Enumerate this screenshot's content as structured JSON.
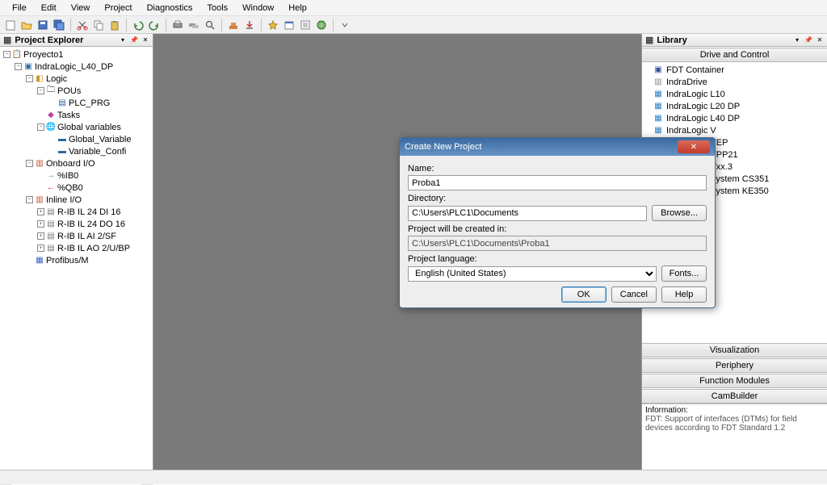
{
  "menu": [
    "File",
    "Edit",
    "View",
    "Project",
    "Diagnostics",
    "Tools",
    "Window",
    "Help"
  ],
  "explorer": {
    "title": "Project Explorer",
    "root": "Proyecto1",
    "indra": "IndraLogic_L40_DP",
    "logic": "Logic",
    "pous": "POUs",
    "plc_prg": "PLC_PRG",
    "tasks": "Tasks",
    "globals": "Global variables",
    "gvar": "Global_Variable",
    "vconf": "Variable_Confi",
    "onboard": "Onboard I/O",
    "ib0": "%IB0",
    "qb0": "%QB0",
    "inline": "Inline I/O",
    "io1": "R-IB IL 24 DI 16",
    "io2": "R-IB IL 24 DO 16",
    "io3": "R-IB IL AI 2/SF",
    "io4": "R-IB IL AO 2/U/BP",
    "profibus": "Profibus/M"
  },
  "library": {
    "title": "Library",
    "cat1": "Drive and Control",
    "items": [
      "FDT Container",
      "IndraDrive",
      "IndraLogic L10",
      "IndraLogic L20 DP",
      "IndraLogic L40 DP",
      "IndraLogic V",
      "IndraLogic VEP",
      "IndraLogic VPP21",
      "IndraLogic Vxx.3",
      "Tightening System CS351",
      "Tightening System KE350"
    ],
    "cat2": "Visualization",
    "cat3": "Periphery",
    "cat4": "Function Modules",
    "cat5": "CamBuilder",
    "info_label": "Information:",
    "info_text": "FDT: Support of interfaces (DTMs) for field devices according to FDT Standard 1.2"
  },
  "dialog": {
    "title": "Create New Project",
    "name_label": "Name:",
    "name_value": "Proba1",
    "dir_label": "Directory:",
    "dir_value": "C:\\Users\\PLC1\\Documents",
    "browse": "Browse...",
    "created_label": "Project will be created in:",
    "created_value": "C:\\Users\\PLC1\\Documents\\Proba1",
    "lang_label": "Project language:",
    "lang_value": "English (United States)",
    "fonts": "Fonts...",
    "ok": "OK",
    "cancel": "Cancel",
    "help": "Help"
  }
}
